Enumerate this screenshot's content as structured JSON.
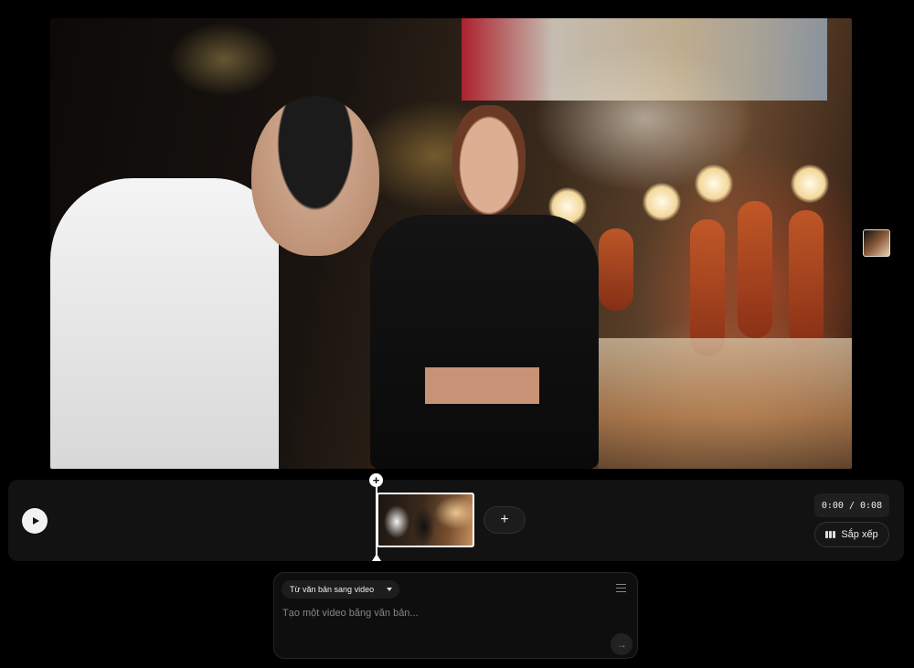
{
  "timeline": {
    "current_time": "0:00 / 0:08",
    "arrange_label": "Sắp xếp",
    "add_clip_symbol": "+",
    "playhead_symbol": "+"
  },
  "prompt": {
    "mode_label": "Từ văn bản sang video",
    "placeholder": "Tạo một video bằng văn bản...",
    "send_symbol": "→"
  },
  "icons": {
    "play": "play-icon",
    "arrange": "arrange-icon",
    "tune": "sliders-icon",
    "send": "arrow-right-icon"
  },
  "colors": {
    "background": "#000000",
    "panel": "#121212",
    "pill": "#1f1f1f",
    "accent_white": "#ffffff"
  }
}
